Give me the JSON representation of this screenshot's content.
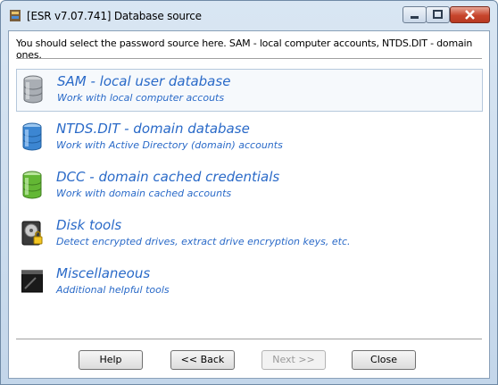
{
  "window": {
    "title": "[ESR v7.07.741]  Database source",
    "controls": {
      "minimize": "minimize",
      "maximize": "maximize",
      "close": "close"
    }
  },
  "header": {
    "instruction": "You should select the password source here. SAM - local computer accounts, NTDS.DIT - domain ones."
  },
  "options": [
    {
      "title": "SAM - local user database",
      "subtitle": "Work with local computer accouts",
      "icon": "database-gray-icon",
      "selected": true
    },
    {
      "title": "NTDS.DIT - domain database",
      "subtitle": "Work with Active Directory (domain) accounts",
      "icon": "database-blue-icon",
      "selected": false
    },
    {
      "title": "DCC - domain cached credentials",
      "subtitle": "Work with domain cached accounts",
      "icon": "database-green-icon",
      "selected": false
    },
    {
      "title": "Disk tools",
      "subtitle": "Detect encrypted drives, extract drive encryption keys, etc.",
      "icon": "disk-lock-icon",
      "selected": false
    },
    {
      "title": "Miscellaneous",
      "subtitle": "Additional helpful tools",
      "icon": "terminal-icon",
      "selected": false
    }
  ],
  "buttons": {
    "help": "Help",
    "back": "<< Back",
    "next": "Next >>",
    "close": "Close"
  },
  "colors": {
    "link": "#2a6ac8",
    "close_button": "#c7452c"
  }
}
